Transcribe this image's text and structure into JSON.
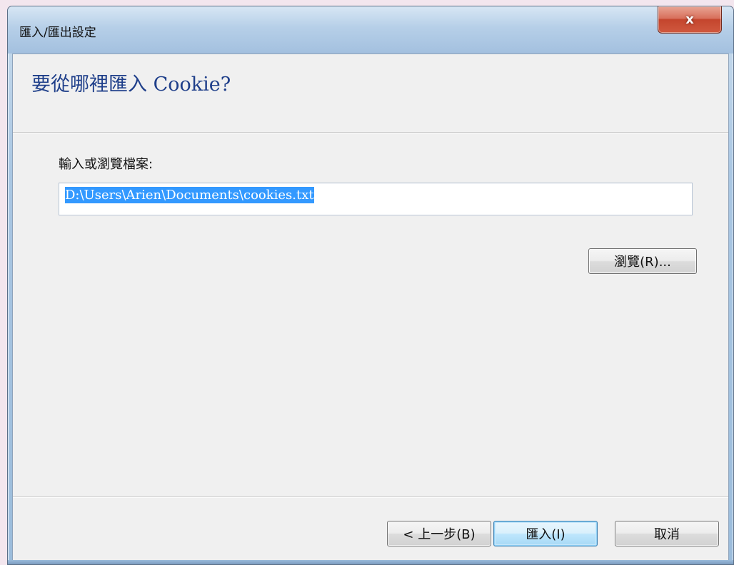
{
  "window": {
    "title": "匯入/匯出設定",
    "close_icon": "close-icon",
    "close_symbol": "x"
  },
  "page": {
    "title": "要從哪裡匯入 Cookie?"
  },
  "file_field": {
    "label": "輸入或瀏覽檔案:",
    "value": "D:\\Users\\Arien\\Documents\\cookies.txt"
  },
  "buttons": {
    "browse": "瀏覽(R)...",
    "back": "< 上一步(B)",
    "import": "匯入(I)",
    "cancel": "取消"
  },
  "colors": {
    "title_color": "#1f3f8a",
    "selection": "#3399ff",
    "close_button": "#c4452d"
  }
}
